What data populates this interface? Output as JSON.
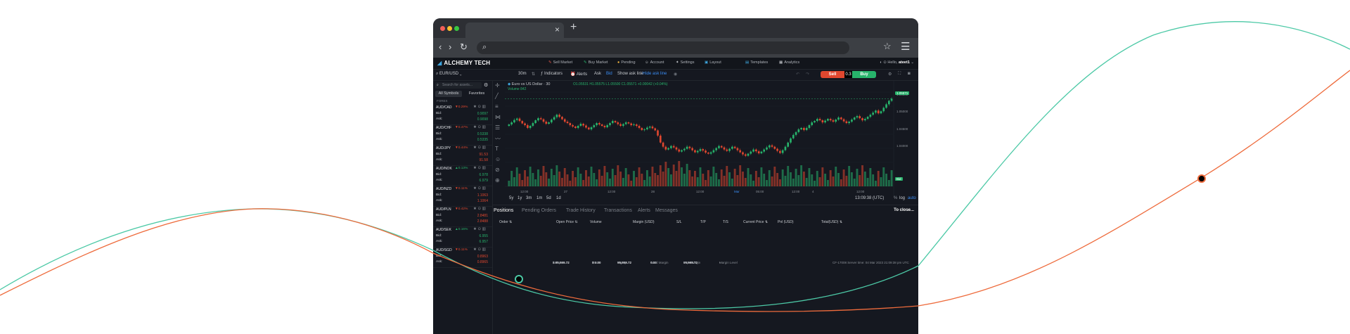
{
  "browser": {
    "tab_close": "×",
    "new_tab": "+",
    "back": "‹",
    "forward": "›",
    "reload": "↻",
    "search_icon": "⌕",
    "bookmark": "☆",
    "menu": "☰"
  },
  "app": {
    "logo": "ALCHEMY TECH",
    "nav": [
      {
        "label": "Sell Market",
        "icon": "sell-icon"
      },
      {
        "label": "Buy Market",
        "icon": "buy-icon"
      },
      {
        "label": "Pending",
        "icon": "pending-icon"
      },
      {
        "label": "Account",
        "icon": "account-icon"
      },
      {
        "label": "Settings",
        "icon": "settings-icon"
      },
      {
        "label": "Layout",
        "icon": "layout-icon"
      },
      {
        "label": "Templates",
        "icon": "templates-icon"
      },
      {
        "label": "Analytics",
        "icon": "analytics-icon"
      }
    ],
    "hello": "Hello,",
    "user": "ateet1"
  },
  "toolbar": {
    "symbol": "EUR/USD",
    "interval": "30m",
    "indicators": "Indicators",
    "alerts": "Alerts",
    "ask": "Ask",
    "bid": "Bid",
    "show_ask_line": "Show ask line",
    "hide_ask_line": "Hide ask line",
    "sell": "Sell",
    "lot": "0.3",
    "buy": "Buy"
  },
  "sidebar": {
    "search_placeholder": "Search for assets...",
    "tab_all": "All Symbols",
    "tab_fav": "Favorites",
    "group": "FOREX",
    "bid_label": "Bid:",
    "ask_label": "Ask:",
    "symbols": [
      {
        "name": "AUD/CAD",
        "change": "▼0.29%",
        "dir": "down",
        "bid": "0.9097",
        "ask": "0.9098",
        "bid_dir": "up",
        "ask_dir": "up"
      },
      {
        "name": "AUD/CHF",
        "change": "▼0.47%",
        "dir": "down",
        "bid": "0.5338",
        "ask": "0.5335",
        "bid_dir": "up",
        "ask_dir": "up"
      },
      {
        "name": "AUD/JPY",
        "change": "▼0.44%",
        "dir": "down",
        "bid": "91.53",
        "ask": "91.58",
        "bid_dir": "down",
        "ask_dir": "down"
      },
      {
        "name": "AUD/NOK",
        "change": "▲0.13%",
        "dir": "up",
        "bid": "6.978",
        "ask": "6.979",
        "bid_dir": "up",
        "ask_dir": "up"
      },
      {
        "name": "AUD/NZD",
        "change": "▼0.11%",
        "dir": "down",
        "bid": "1.1063",
        "ask": "1.1064",
        "bid_dir": "down",
        "ask_dir": "down"
      },
      {
        "name": "AUD/PLN",
        "change": "▼0.42%",
        "dir": "down",
        "bid": "2.8481",
        "ask": "2.8488",
        "bid_dir": "down",
        "ask_dir": "down"
      },
      {
        "name": "AUD/SEK",
        "change": "▲0.16%",
        "dir": "up",
        "bid": "6.955",
        "ask": "6.957",
        "bid_dir": "up",
        "ask_dir": "up"
      },
      {
        "name": "AUD/SGD",
        "change": "▼0.11%",
        "dir": "down",
        "bid": "0.8963",
        "ask": "0.8965",
        "bid_dir": "down",
        "ask_dir": "down"
      }
    ]
  },
  "chart": {
    "title": "Euro vs US Dollar · 30",
    "ohlc": "O1.05531 H1.05575 L1.05500 C1.05571 +0.00042 (+0.04%)",
    "volume": "Volume 842",
    "last_price": "1.05571",
    "bid_tag": "Bid",
    "y_ticks": [
      "1.05600",
      "1.05000",
      "1.04500",
      "1.04000"
    ],
    "x_ticks": [
      "12:00",
      "27",
      "12:00",
      "28",
      "12:00",
      "Mar",
      "05:00",
      "12:00",
      "4",
      "12:00"
    ],
    "timeframes": [
      "5y",
      "1y",
      "3m",
      "1m",
      "5d",
      "1d"
    ],
    "utc_time": "13:09:38 (UTC)",
    "scale_opts": [
      "%",
      "log",
      "auto"
    ]
  },
  "chart_data": {
    "type": "candlestick",
    "title": "Euro vs US Dollar · 30",
    "ylim": [
      1.0385,
      1.0575
    ],
    "close_trend": [
      1.0482,
      1.0488,
      1.0495,
      1.0499,
      1.0492,
      1.0485,
      1.048,
      1.0472,
      1.0478,
      1.0486,
      1.0494,
      1.05,
      1.0497,
      1.049,
      1.0484,
      1.0488,
      1.0496,
      1.0503,
      1.051,
      1.0504,
      1.0497,
      1.049,
      1.0486,
      1.048,
      1.0476,
      1.0472,
      1.0478,
      1.0484,
      1.0479,
      1.0473,
      1.0468,
      1.0474,
      1.048,
      1.0486,
      1.0482,
      1.0478,
      1.0474,
      1.048,
      1.0486,
      1.0492,
      1.0488,
      1.0483,
      1.0478,
      1.0483,
      1.0488,
      1.0485,
      1.048,
      1.0482,
      1.0478,
      1.0472,
      1.0466,
      1.0468,
      1.0473,
      1.0476,
      1.0471,
      1.0465,
      1.045,
      1.043,
      1.0418,
      1.041,
      1.0414,
      1.042,
      1.0416,
      1.041,
      1.0404,
      1.0408,
      1.0412,
      1.0418,
      1.0414,
      1.0408,
      1.0402,
      1.0406,
      1.0411,
      1.0407,
      1.0401,
      1.0398,
      1.0402,
      1.0408,
      1.0414,
      1.042,
      1.0416,
      1.041,
      1.0406,
      1.0412,
      1.0418,
      1.0414,
      1.0408,
      1.0402,
      1.0396,
      1.0392,
      1.0398,
      1.0404,
      1.041,
      1.0405,
      1.0399,
      1.0404,
      1.041,
      1.0416,
      1.0422,
      1.0418,
      1.0412,
      1.0406,
      1.04,
      1.0408,
      1.0418,
      1.043,
      1.0442,
      1.0452,
      1.046,
      1.0468,
      1.0472,
      1.0466,
      1.0472,
      1.048,
      1.0488,
      1.0492,
      1.0498,
      1.0494,
      1.0488,
      1.0493,
      1.0498,
      1.0494,
      1.049,
      1.0496,
      1.0502,
      1.0497,
      1.0491,
      1.0486,
      1.049,
      1.0496,
      1.0502,
      1.0506,
      1.05,
      1.0494,
      1.0498,
      1.0504,
      1.051,
      1.0516,
      1.0522,
      1.0514,
      1.052,
      1.053,
      1.054,
      1.055,
      1.0556
    ]
  },
  "panel": {
    "tabs": [
      "Positions",
      "Pending Orders",
      "Trade History",
      "Transactions",
      "Alerts",
      "Messages"
    ],
    "close_all": "To close...",
    "columns": [
      "Order ⇅",
      "Open Price ⇅",
      "Volume",
      "Margin (USD)",
      "S/L",
      "T/P",
      "T/S",
      "Current Price ⇅",
      "Pnl (USD)",
      "Total(USD) ⇅"
    ]
  },
  "status": {
    "balance_label": "Balance",
    "balance": "$ 99,999.72",
    "upl_label": "UPL",
    "upl": "$ 0.00",
    "equity_label": "Equity",
    "equity": "99,999.72",
    "used_margin_label": "Used Margin",
    "used_margin": "0.00",
    "free_margin_label": "Free Margin",
    "free_margin": "99,999.72",
    "margin_level_label": "Margin Level",
    "margin_level": "-",
    "server": "CF-17008 Server time: 04 Mar 2023 21:09:38 pm UTC"
  },
  "colors": {
    "wave_teal": "#4cc9a6",
    "wave_orange": "#ee6b3c",
    "up": "#27b36b",
    "down": "#e0472f",
    "accent_blue": "#3a8df5"
  }
}
